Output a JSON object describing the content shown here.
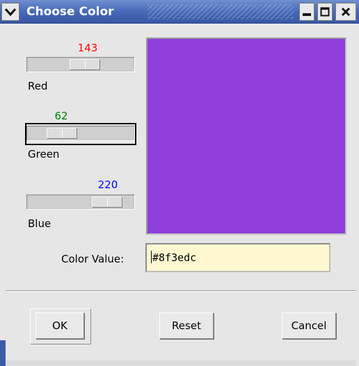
{
  "window": {
    "title": "Choose Color"
  },
  "sliders": {
    "red": {
      "value": "143",
      "label": "Red",
      "level": 143,
      "max": 255
    },
    "green": {
      "value": "62",
      "label": "Green",
      "level": 62,
      "max": 255
    },
    "blue": {
      "value": "220",
      "label": "Blue",
      "level": 220,
      "max": 255
    }
  },
  "preview": {
    "color": "#8f3edc"
  },
  "color_value": {
    "label": "Color Value:",
    "value": "#8f3edc"
  },
  "buttons": {
    "ok": "OK",
    "reset": "Reset",
    "cancel": "Cancel"
  },
  "icons": {
    "menu": "chevron-down-icon",
    "minimize": "minimize-icon",
    "maximize": "maximize-icon",
    "close": "close-icon"
  },
  "colors": {
    "red_value": "#ff0000",
    "green_value": "#008000",
    "blue_value": "#0000ff",
    "title_bar": "#4769b8"
  }
}
